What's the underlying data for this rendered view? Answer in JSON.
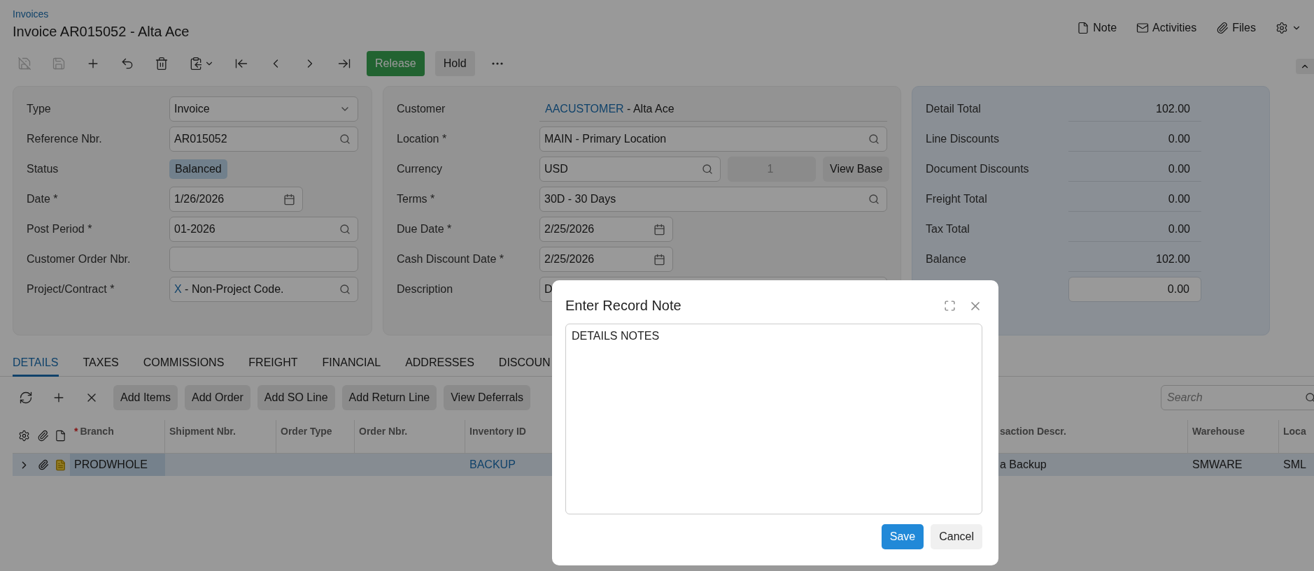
{
  "breadcrumb": "Invoices",
  "title": "Invoice AR015052 - Alta Ace",
  "header_actions": [
    "Note",
    "Activities",
    "Files"
  ],
  "toolbar": {
    "icons": [
      {
        "disabled": true
      },
      {
        "disabled": true
      },
      {
        "disabled": false
      },
      {
        "disabled": false
      },
      {
        "disabled": false
      },
      {
        "disabled": false
      },
      {
        "disabled": false
      },
      {
        "disabled": false
      },
      {
        "disabled": false
      },
      {
        "disabled": false
      }
    ],
    "buttons": [
      {
        "label": "Release",
        "kind": "primary"
      },
      {
        "label": "Hold",
        "kind": "secondary"
      }
    ]
  },
  "summary_panel": {
    "rows": [
      {
        "label": "Type",
        "kind": "select",
        "value": "Invoice"
      },
      {
        "label": "Reference Nbr.",
        "kind": "lookup",
        "value": "AR015052"
      },
      {
        "label": "Status",
        "kind": "badge",
        "value": "Balanced"
      },
      {
        "label": "Date *",
        "kind": "date",
        "value": "1/26/2026"
      },
      {
        "label": "Post Period *",
        "kind": "lookup",
        "value": "01-2026"
      },
      {
        "label": "Customer Order Nbr.",
        "kind": "text"
      },
      {
        "label": "Project/Contract *",
        "kind": "lookup",
        "link": "X",
        "value": " - Non-Project Code."
      }
    ]
  },
  "customer_panel": {
    "rows": [
      {
        "label": "Customer",
        "kind": "display",
        "link": "AACUSTOMER",
        "value": " - Alta Ace"
      },
      {
        "label": "Location *",
        "kind": "lookup",
        "value": "MAIN - Primary Location"
      },
      {
        "label": "Currency",
        "kind": "currency",
        "value": "USD",
        "rate": "1",
        "button": "View Base"
      },
      {
        "label": "Terms *",
        "kind": "lookup",
        "value": "30D - 30 Days"
      },
      {
        "label": "Due Date *",
        "kind": "date",
        "value": "2/25/2026"
      },
      {
        "label": "Cash Discount Date *",
        "kind": "date",
        "value": "2/25/2026"
      },
      {
        "label": "Description",
        "kind": "text",
        "value": "D"
      }
    ]
  },
  "totals_panel": {
    "rows": [
      {
        "label": "Detail Total",
        "kind": "total",
        "value": "102.00"
      },
      {
        "label": "Line Discounts",
        "kind": "total",
        "value": "0.00"
      },
      {
        "label": "Document Discounts",
        "kind": "total",
        "value": "0.00"
      },
      {
        "label": "Freight Total",
        "kind": "total",
        "value": "0.00"
      },
      {
        "label": "Tax Total",
        "kind": "total",
        "value": "0.00"
      },
      {
        "label": "Balance",
        "kind": "total",
        "value": "102.00"
      },
      {
        "kind": "input",
        "value": "0.00"
      }
    ]
  },
  "tabs": [
    {
      "label": "DETAILS",
      "selected": true
    },
    {
      "label": "TAXES",
      "selected": false
    },
    {
      "label": "COMMISSIONS",
      "selected": false
    },
    {
      "label": "FREIGHT",
      "selected": false
    },
    {
      "label": "FINANCIAL",
      "selected": false
    },
    {
      "label": "ADDRESSES",
      "selected": false
    },
    {
      "label": "DISCOUN",
      "selected": false
    }
  ],
  "grid_toolbar": {
    "buttons": [
      "Add Items",
      "Add Order",
      "Add SO Line",
      "Add Return Line",
      "View Deferrals"
    ],
    "search": {
      "placeholder": "Search"
    }
  },
  "grid": {
    "columns": [
      {
        "kind": "text",
        "label": "Branch",
        "mark": "*"
      },
      {
        "kind": "text",
        "label": "Shipment Nbr."
      },
      {
        "kind": "text",
        "label": "Order Type"
      },
      {
        "kind": "text",
        "label": "Order Nbr."
      },
      {
        "kind": "link",
        "label": "Inventory ID"
      },
      {
        "kind": "text",
        "label": "saction Descr."
      },
      {
        "kind": "text",
        "label": "Warehouse"
      },
      {
        "kind": "text",
        "label": "Loca"
      }
    ],
    "rows": [
      {
        "selected": true,
        "cells": [
          {
            "text": "PRODWHOLE",
            "focused": true
          },
          null,
          null,
          null,
          {
            "text": "BACKUP",
            "focused": false
          },
          {
            "text": "a Backup",
            "focused": false
          },
          {
            "text": "SMWARE",
            "focused": false
          },
          {
            "text": "SML",
            "focused": false
          }
        ]
      }
    ]
  },
  "dialog": {
    "title": "Enter Record Note",
    "text": "DETAILS NOTES",
    "buttons": [
      {
        "label": "Save",
        "kind": "primary"
      },
      {
        "label": "Cancel",
        "kind": "secondary"
      }
    ]
  }
}
